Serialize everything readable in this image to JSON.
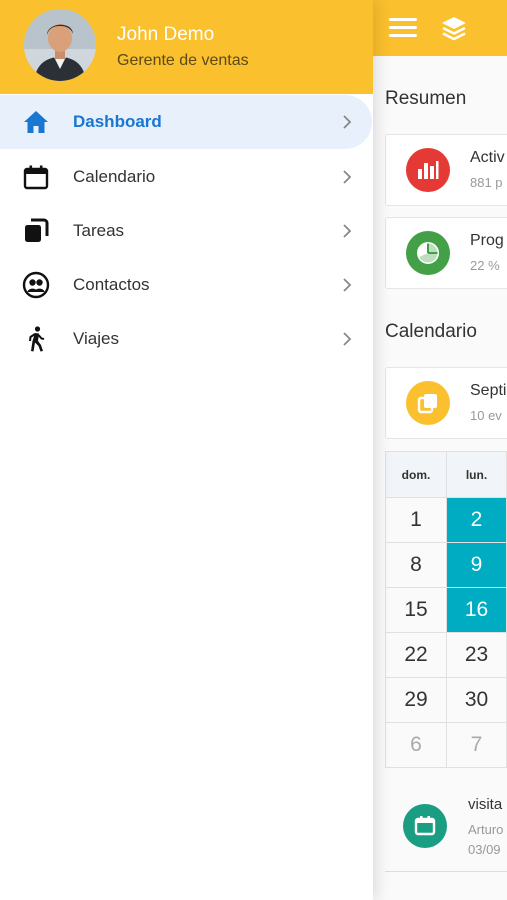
{
  "drawer": {
    "user_name": "John Demo",
    "user_role": "Gerente de ventas",
    "items": [
      {
        "label": "Dashboard",
        "icon": "home-icon",
        "active": true
      },
      {
        "label": "Calendario",
        "icon": "calendar-icon",
        "active": false
      },
      {
        "label": "Tareas",
        "icon": "tasks-icon",
        "active": false
      },
      {
        "label": "Contactos",
        "icon": "contacts-icon",
        "active": false
      },
      {
        "label": "Viajes",
        "icon": "walking-icon",
        "active": false
      }
    ]
  },
  "main": {
    "resumen_title": "Resumen",
    "cards": [
      {
        "title": "Activ",
        "subtitle": "881 p",
        "icon": "bar-chart-icon",
        "color": "#e53935"
      },
      {
        "title": "Prog",
        "subtitle": "22 %",
        "icon": "pie-chart-icon",
        "color": "#43a047"
      }
    ],
    "calendario_title": "Calendario",
    "calendar_card": {
      "title": "Septi",
      "subtitle": "10 ev",
      "icon": "copy-icon",
      "color": "#fbc02d"
    },
    "calendar": {
      "headers": [
        "dom.",
        "lun."
      ],
      "rows": [
        [
          "1",
          "2"
        ],
        [
          "8",
          "9"
        ],
        [
          "15",
          "16"
        ],
        [
          "22",
          "23"
        ],
        [
          "29",
          "30"
        ],
        [
          "6",
          "7"
        ]
      ],
      "selected_days": [
        "2",
        "9",
        "16"
      ],
      "muted_days": [
        "6",
        "7"
      ]
    },
    "event": {
      "title": "visita",
      "line2": "Arturo",
      "line3": "03/09",
      "icon": "calendar-icon",
      "color": "#1a9e82"
    }
  },
  "colors": {
    "header": "#fbc02d",
    "accent": "#1976d2",
    "selected": "#00acc1"
  }
}
